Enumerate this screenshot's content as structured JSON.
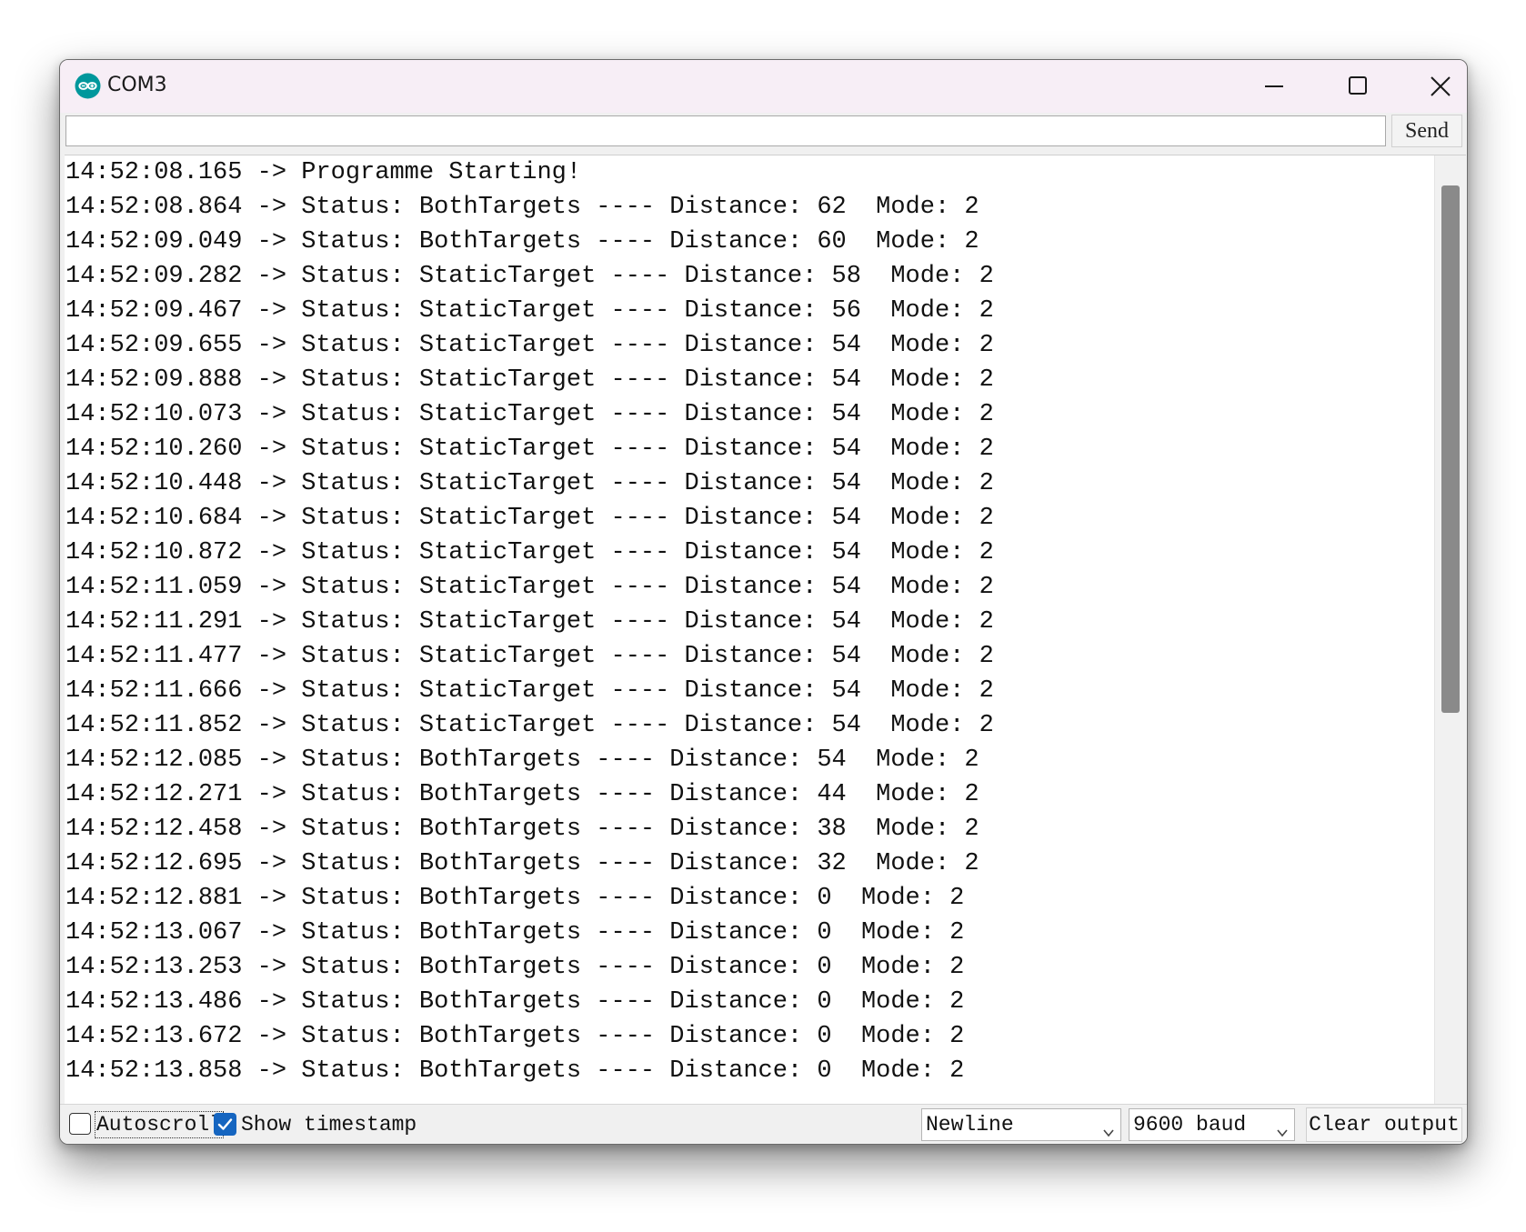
{
  "window": {
    "title": "COM3"
  },
  "send_row": {
    "input_value": "",
    "send_label": "Send"
  },
  "output": {
    "lines": [
      "14:52:08.165 -> Programme Starting!",
      "14:52:08.864 -> Status: BothTargets ---- Distance: 62  Mode: 2",
      "14:52:09.049 -> Status: BothTargets ---- Distance: 60  Mode: 2",
      "14:52:09.282 -> Status: StaticTarget ---- Distance: 58  Mode: 2",
      "14:52:09.467 -> Status: StaticTarget ---- Distance: 56  Mode: 2",
      "14:52:09.655 -> Status: StaticTarget ---- Distance: 54  Mode: 2",
      "14:52:09.888 -> Status: StaticTarget ---- Distance: 54  Mode: 2",
      "14:52:10.073 -> Status: StaticTarget ---- Distance: 54  Mode: 2",
      "14:52:10.260 -> Status: StaticTarget ---- Distance: 54  Mode: 2",
      "14:52:10.448 -> Status: StaticTarget ---- Distance: 54  Mode: 2",
      "14:52:10.684 -> Status: StaticTarget ---- Distance: 54  Mode: 2",
      "14:52:10.872 -> Status: StaticTarget ---- Distance: 54  Mode: 2",
      "14:52:11.059 -> Status: StaticTarget ---- Distance: 54  Mode: 2",
      "14:52:11.291 -> Status: StaticTarget ---- Distance: 54  Mode: 2",
      "14:52:11.477 -> Status: StaticTarget ---- Distance: 54  Mode: 2",
      "14:52:11.666 -> Status: StaticTarget ---- Distance: 54  Mode: 2",
      "14:52:11.852 -> Status: StaticTarget ---- Distance: 54  Mode: 2",
      "14:52:12.085 -> Status: BothTargets ---- Distance: 54  Mode: 2",
      "14:52:12.271 -> Status: BothTargets ---- Distance: 44  Mode: 2",
      "14:52:12.458 -> Status: BothTargets ---- Distance: 38  Mode: 2",
      "14:52:12.695 -> Status: BothTargets ---- Distance: 32  Mode: 2",
      "14:52:12.881 -> Status: BothTargets ---- Distance: 0  Mode: 2",
      "14:52:13.067 -> Status: BothTargets ---- Distance: 0  Mode: 2",
      "14:52:13.253 -> Status: BothTargets ---- Distance: 0  Mode: 2",
      "14:52:13.486 -> Status: BothTargets ---- Distance: 0  Mode: 2",
      "14:52:13.672 -> Status: BothTargets ---- Distance: 0  Mode: 2",
      "14:52:13.858 -> Status: BothTargets ---- Distance: 0  Mode: 2"
    ]
  },
  "bottom_bar": {
    "autoscroll_label": "Autoscroll",
    "autoscroll_checked": false,
    "timestamp_label": "Show timestamp",
    "timestamp_checked": true,
    "line_ending_value": "Newline",
    "baud_value": "9600 baud",
    "clear_label": "Clear output"
  },
  "icons": {
    "app": "arduino-logo-icon",
    "minimize": "minimize-icon",
    "maximize": "maximize-icon",
    "close": "close-icon",
    "dropdown": "chevron-down-icon",
    "check": "checkmark-icon"
  },
  "colors": {
    "titlebar": "#f7eef6",
    "arduino_teal": "#00979c",
    "checkbox_accent": "#1565c0",
    "scroll_thumb": "#8a8a8a"
  }
}
